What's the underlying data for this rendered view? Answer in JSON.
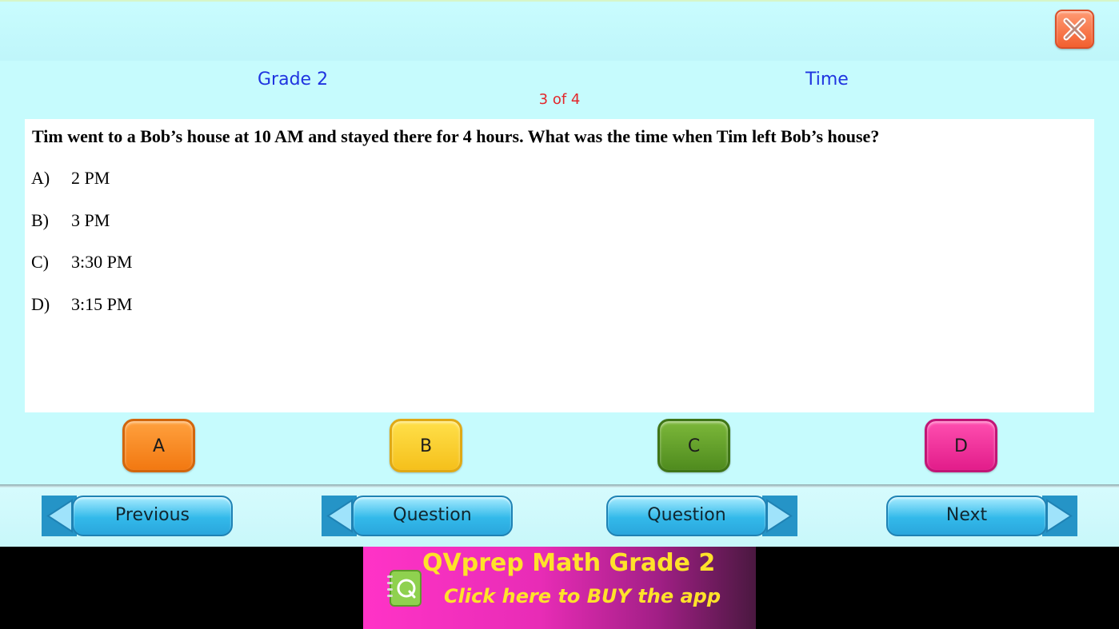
{
  "header": {
    "grade": "Grade 2",
    "topic": "Time",
    "progress": "3 of 4"
  },
  "question": {
    "text": "Tim went to a Bob’s house at 10 AM and stayed there for 4 hours. What was the time when Tim left Bob’s house?",
    "options": [
      {
        "letter": "A)",
        "text": "2 PM"
      },
      {
        "letter": "B)",
        "text": "3 PM"
      },
      {
        "letter": "C)",
        "text": "3:30 PM"
      },
      {
        "letter": "D)",
        "text": "3:15 PM"
      }
    ]
  },
  "answers": [
    "A",
    "B",
    "C",
    "D"
  ],
  "nav": {
    "previous": "Previous",
    "prev_question": "Question",
    "next_question": "Question",
    "next": "Next"
  },
  "ad": {
    "title": "QVprep Math Grade 2",
    "subtitle": "Click here to BUY the app"
  },
  "icons": {
    "close": "close-icon",
    "left_arrow": "arrow-left-icon",
    "right_arrow": "arrow-right-icon",
    "app_logo": "notebook-q-icon"
  },
  "colors": {
    "background": "#c6fbfd",
    "header_text": "#1f34e0",
    "progress_text": "#e3262a",
    "answer_a": "#f27811",
    "answer_b": "#f5c01b",
    "answer_c": "#4f8b1e",
    "answer_d": "#e21c8a",
    "nav_button": "#2aa6dc",
    "ad_text": "#ffe22a"
  }
}
